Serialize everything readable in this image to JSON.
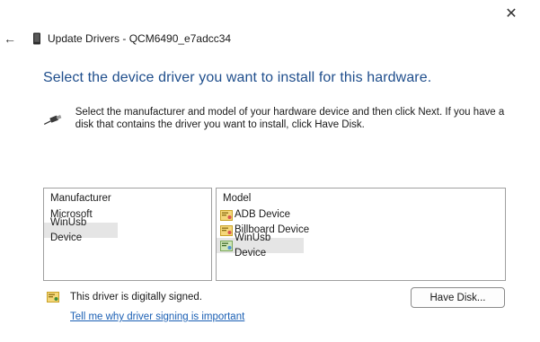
{
  "window": {
    "title": "Update Drivers - QCM6490_e7adcc34",
    "close_glyph": "✕",
    "back_glyph": "←"
  },
  "heading": "Select the device driver you want to install for this hardware.",
  "instructions": "Select the manufacturer and model of your hardware device and then click Next. If you have a disk that contains the driver you want to install, click Have Disk.",
  "manufacturer_list": {
    "header": "Manufacturer",
    "items": [
      "Microsoft",
      "WinUsb Device"
    ],
    "selected": "WinUsb Device"
  },
  "model_list": {
    "header": "Model",
    "items": [
      "ADB Device",
      "Billboard Device",
      "WinUsb Device"
    ],
    "selected": "WinUsb Device"
  },
  "signature": {
    "status": "This driver is digitally signed.",
    "link": "Tell me why driver signing is important"
  },
  "buttons": {
    "have_disk": "Have Disk..."
  },
  "icons": {
    "title": "device-icon",
    "intro": "usb-cable-icon",
    "model_item": "driver-certificate-icon",
    "signed": "certificate-icon"
  },
  "colors": {
    "heading": "#1f4e8c",
    "link": "#1a5fb4",
    "selection": "#e5e5e5"
  }
}
